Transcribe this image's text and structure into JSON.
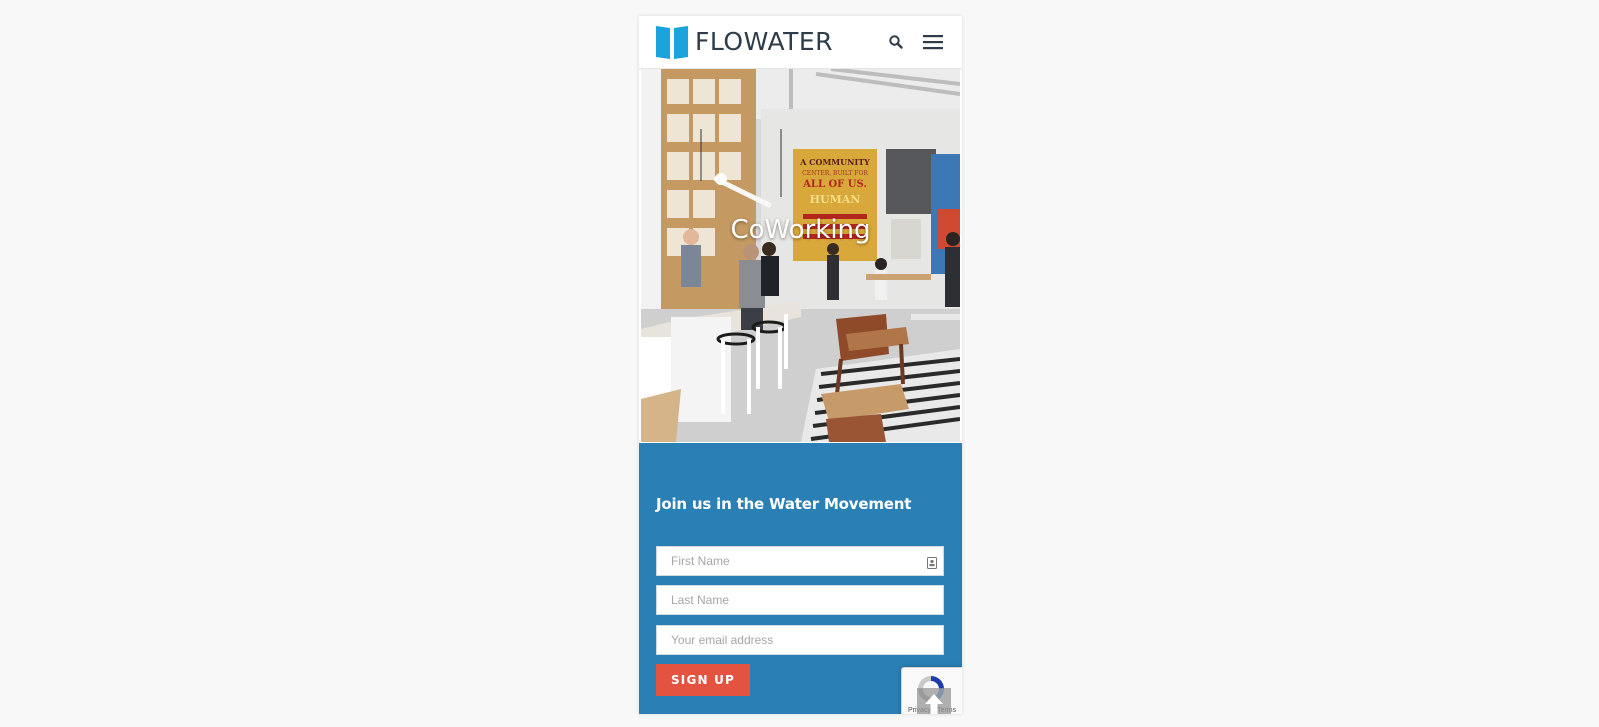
{
  "brand": {
    "name": "FLOWATER",
    "logo_color": "#1aa3dc",
    "text_color": "#2f3d4a"
  },
  "header": {
    "search_icon": "search-icon",
    "menu_icon": "hamburger-menu-icon"
  },
  "hero": {
    "title": "CoWorking",
    "image": "coworking-interior-photo",
    "poster_lines": [
      "A COMMUNITY",
      "CENTER, BUILT FOR",
      "ALL OF US.",
      "HUMAN"
    ]
  },
  "signup": {
    "heading": "Join us in the Water Movement",
    "first_name_placeholder": "First Name",
    "last_name_placeholder": "Last Name",
    "email_placeholder": "Your email address",
    "button_label": "SIGN UP",
    "background_color": "#2a7fb5",
    "button_color": "#e4533f"
  },
  "recaptcha": {
    "privacy_label": "Privacy",
    "terms_label": "Terms"
  },
  "back_to_top": {
    "icon": "arrow-up-icon"
  }
}
